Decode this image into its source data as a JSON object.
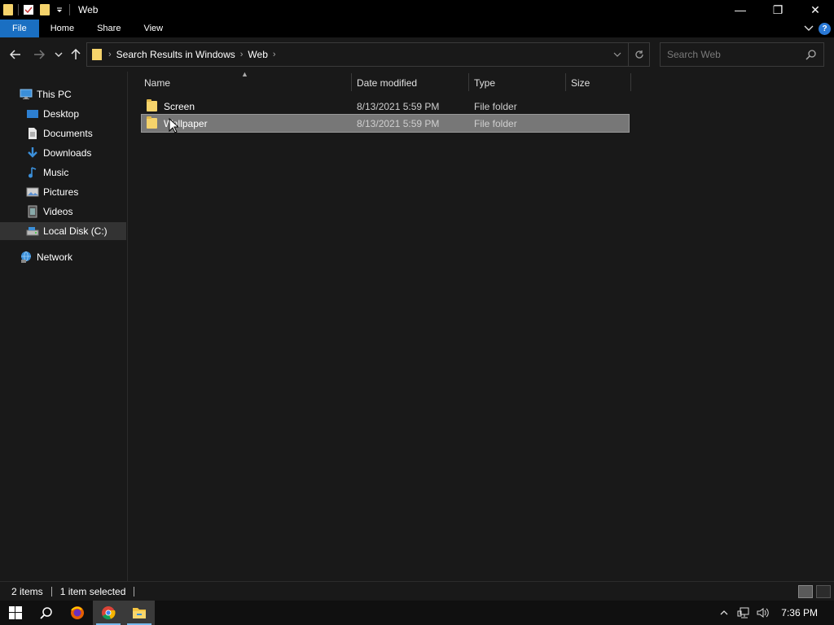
{
  "window": {
    "title": "Web",
    "controls": {
      "minimize": "—",
      "maximize": "❐",
      "close": "✕"
    }
  },
  "ribbon": {
    "tabs": [
      {
        "label": "File",
        "active": true
      },
      {
        "label": "Home"
      },
      {
        "label": "Share"
      },
      {
        "label": "View"
      }
    ],
    "help": "?"
  },
  "address": {
    "crumbs": [
      "Search Results in Windows",
      "Web"
    ]
  },
  "search": {
    "placeholder": "Search Web"
  },
  "nav_pane": {
    "items": [
      {
        "label": "This PC",
        "icon": "monitor-icon"
      },
      {
        "label": "Desktop",
        "icon": "desktop-icon"
      },
      {
        "label": "Documents",
        "icon": "documents-icon"
      },
      {
        "label": "Downloads",
        "icon": "downloads-icon"
      },
      {
        "label": "Music",
        "icon": "music-icon"
      },
      {
        "label": "Pictures",
        "icon": "pictures-icon"
      },
      {
        "label": "Videos",
        "icon": "videos-icon"
      },
      {
        "label": "Local Disk (C:)",
        "icon": "disk-icon",
        "selected": true
      },
      {
        "label": "Network",
        "icon": "network-icon"
      }
    ]
  },
  "file_list": {
    "columns": [
      "Name",
      "Date modified",
      "Type",
      "Size"
    ],
    "rows": [
      {
        "name": "Screen",
        "date": "8/13/2021 5:59 PM",
        "type": "File folder",
        "size": ""
      },
      {
        "name": "Wallpaper",
        "date": "8/13/2021 5:59 PM",
        "type": "File folder",
        "size": "",
        "selected": true
      }
    ]
  },
  "status": {
    "item_count": "2 items",
    "selection": "1 item selected"
  },
  "taskbar": {
    "clock": "7:36 PM"
  },
  "colors": {
    "accent": "#1a6fc2",
    "folder": "#f5d36b",
    "selected_row": "#777777",
    "background": "#191919"
  }
}
